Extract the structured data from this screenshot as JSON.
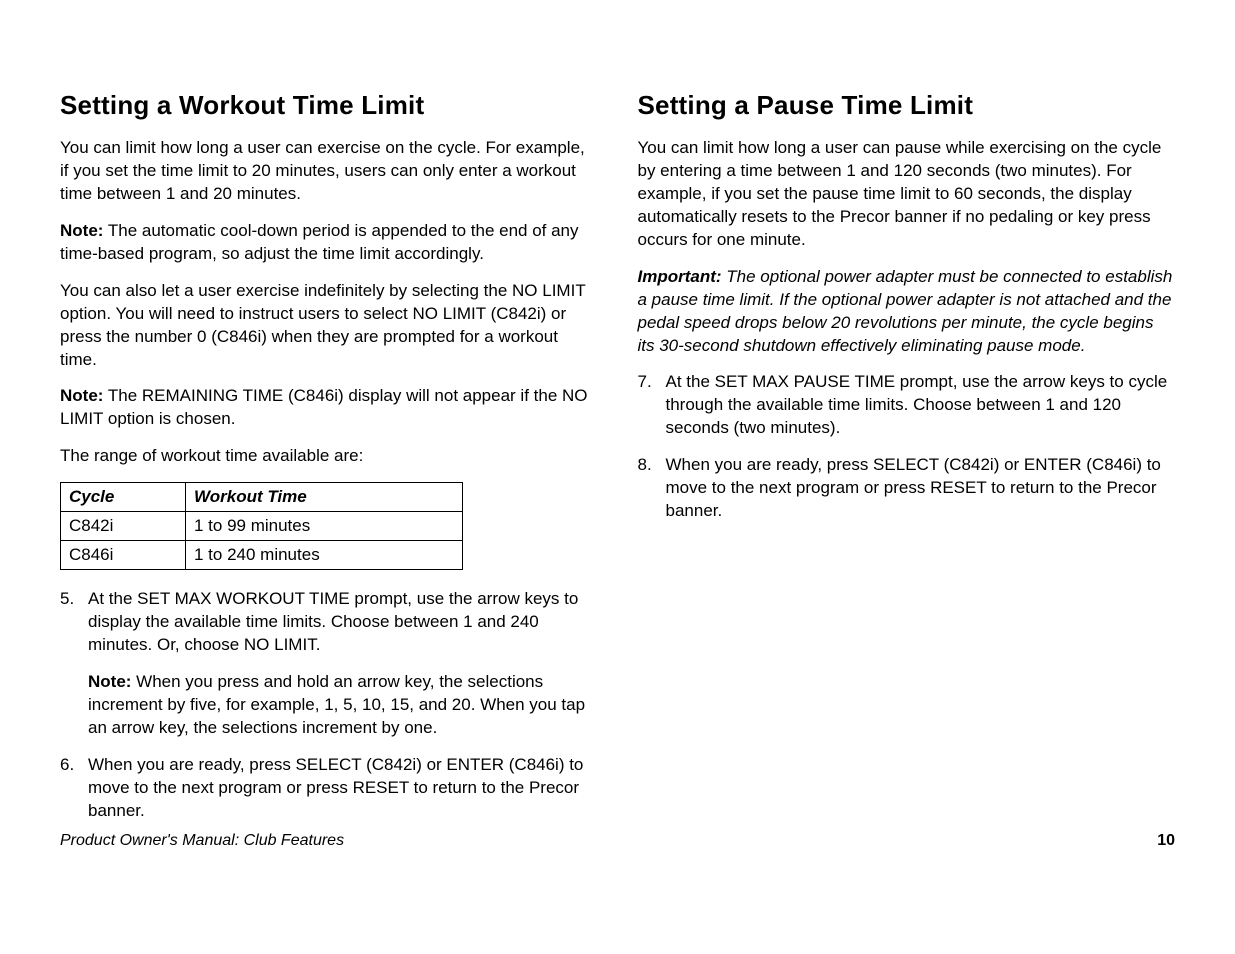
{
  "left": {
    "heading": "Setting a Workout Time Limit",
    "p1": "You can limit how long a user can exercise on the cycle. For example, if you set the time limit to 20 minutes, users can only enter a workout time between 1 and 20 minutes.",
    "note1_label": "Note:",
    "note1_body": " The automatic cool-down period is appended to the end of any time-based program, so adjust the time limit accordingly.",
    "p2": "You can also let a user exercise indefinitely by selecting the NO LIMIT option. You will need to instruct users to select NO LIMIT (C842i) or press the number 0 (C846i) when they are prompted for a workout time.",
    "note2_label": "Note:",
    "note2_body": " The REMAINING TIME (C846i) display will not appear if the NO LIMIT option is chosen.",
    "p3": "The range of workout time available are:",
    "table": {
      "h1": "Cycle",
      "h2": "Workout Time",
      "r1c1": "C842i",
      "r1c2": "1 to 99 minutes",
      "r2c1": "C846i",
      "r2c2": "1 to 240 minutes"
    },
    "li5_num": "5.",
    "li5_body": "At the SET MAX WORKOUT TIME prompt, use the arrow keys to display the available time limits. Choose between 1 and 240 minutes. Or, choose NO LIMIT.",
    "li5_note_label": "Note:",
    "li5_note_body": " When you press and hold an arrow key, the selections increment by five, for example, 1, 5, 10, 15, and 20. When you tap an arrow key, the selections increment by one.",
    "li6_num": "6.",
    "li6_body": "When you are ready, press SELECT (C842i) or ENTER (C846i) to move to the next program or press RESET to return to the Precor banner."
  },
  "right": {
    "heading": "Setting a Pause Time Limit",
    "p1": "You can limit how long a user can pause while exercising on the cycle by entering a time between 1 and 120 seconds (two minutes). For example, if you set the pause time limit to 60 seconds, the display automatically resets to the Precor banner if no pedaling or key press occurs for one minute.",
    "imp_label": "Important:",
    "imp_body": " The optional power adapter must be connected to establish a pause time limit. If the optional power adapter is not attached and the pedal speed drops below 20 revolutions per minute, the cycle begins its 30-second shutdown effectively eliminating pause mode.",
    "li7_num": "7.",
    "li7_body": "At the SET MAX PAUSE TIME prompt, use the arrow keys to cycle through the available time limits. Choose between 1 and 120 seconds (two minutes).",
    "li8_num": "8.",
    "li8_body": "When you are ready, press SELECT (C842i) or ENTER (C846i) to move to the next program or press RESET to return to the Precor banner."
  },
  "footer": {
    "left": "Product Owner's Manual: Club Features",
    "right": "10"
  }
}
